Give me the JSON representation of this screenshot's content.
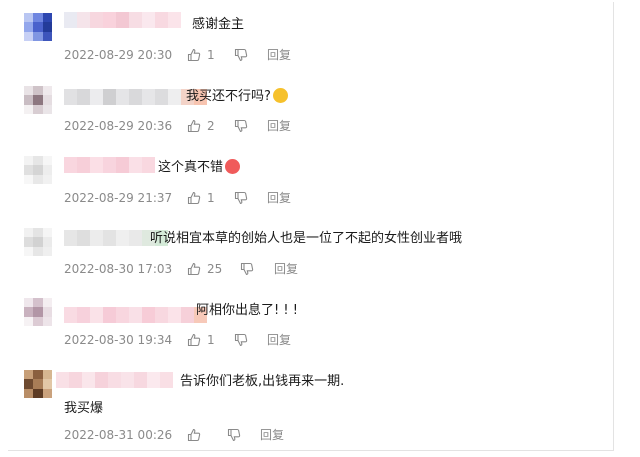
{
  "comments": [
    {
      "text": "感谢金主",
      "emoji": "",
      "time": "2022-08-29 20:30",
      "likes": "1",
      "reply_label": "回复",
      "avatar_colors": [
        "#b9c6f2",
        "#6f86e0",
        "#2d47b0",
        "#93a7ec",
        "#4a62cc",
        "#233b99",
        "#c7d0f5",
        "#8096e2",
        "#3d55bb"
      ],
      "name_colors": [
        "#e9eaf2",
        "#f5e4ea",
        "#f7d7df",
        "#f9d2dc",
        "#f3c8d3",
        "#f7dde4",
        "#fae8ee",
        "#f8d9e1",
        "#fbe4ea"
      ]
    },
    {
      "text": "我买还不行吗?",
      "emoji": "wink-face-emoji",
      "emoji_color": "#f6c12c",
      "time": "2022-08-29 20:36",
      "likes": "2",
      "reply_label": "回复",
      "avatar_colors": [
        "#e9e3e6",
        "#cfc3c8",
        "#efe9ec",
        "#c9bdc3",
        "#8d7780",
        "#e5dde1",
        "#f4f1f2",
        "#d8cdd2",
        "#eae5e8"
      ],
      "name_colors": [
        "#e1e1e3",
        "#d8d8da",
        "#ececee",
        "#cfcfd1",
        "#e5e5e7",
        "#d9d9db",
        "#e6e6e8",
        "#dcdcde",
        "#eeeeef",
        "#f3d3c8",
        "#f7c4b0"
      ]
    },
    {
      "text": "这个真不错",
      "emoji": "heart-eyes-emoji",
      "emoji_color": "#f05b5b",
      "time": "2022-08-29 21:37",
      "likes": "1",
      "reply_label": "回复",
      "avatar_colors": [
        "#f3f3f3",
        "#e6e6e6",
        "#f6f6f6",
        "#e0e0e0",
        "#d5d5d5",
        "#ededed",
        "#f7f7f7",
        "#e8e8e8",
        "#f1f1f1"
      ],
      "name_colors": [
        "#f9d6df",
        "#f7cfd9",
        "#fbdfe6",
        "#f8d4de",
        "#f6cbd6",
        "#fae0e7",
        "#f9d8e0"
      ]
    },
    {
      "text": "听说相宜本草的创始人也是一位了不起的女性创业者哦",
      "emoji": "",
      "time": "2022-08-30 17:03",
      "likes": "25",
      "reply_label": "回复",
      "avatar_colors": [
        "#f1f1f1",
        "#e4e4e4",
        "#f5f5f5",
        "#dddddd",
        "#d2d2d2",
        "#ebebeb",
        "#f6f6f6",
        "#e6e6e6",
        "#efefef"
      ],
      "name_colors": [
        "#e6e6e6",
        "#dedede",
        "#ececec",
        "#e3e3e3",
        "#efefef",
        "#e9e9e9",
        "#dfe9df",
        "#d4ead8"
      ]
    },
    {
      "text": "阿相你出息了! ! !",
      "emoji": "",
      "time": "2022-08-30 19:34",
      "likes": "1",
      "reply_label": "回复",
      "avatar_colors": [
        "#efe7ec",
        "#d4c1cc",
        "#f4eef1",
        "#c9b2bf",
        "#b296a6",
        "#e8dde3",
        "#f6f2f4",
        "#dccbd4",
        "#ede4e9"
      ],
      "name_colors": [
        "#f9dbe3",
        "#f7d1dc",
        "#fae2e8",
        "#f6cbd7",
        "#f8d6df",
        "#f9e0e7",
        "#f7ccd7",
        "#f8d8e0",
        "#fbe3e9",
        "#f6d0d9",
        "#f7c9b9"
      ]
    },
    {
      "text": "告诉你们老板,出钱再来一期.",
      "second_line": "我买爆",
      "emoji": "",
      "time": "2022-08-31 00:26",
      "likes": "",
      "reply_label": "回复",
      "avatar_colors": [
        "#c79f78",
        "#8a5f3e",
        "#d6b690",
        "#6e4a30",
        "#a87d57",
        "#e2c7a6",
        "#b88d66",
        "#5d3b24",
        "#caa27d"
      ],
      "name_colors": [
        "#f9e0e6",
        "#f7d6de",
        "#fae6eb",
        "#f6d2db",
        "#f8dde4",
        "#f9e3e9",
        "#f7d8e0",
        "#fbe9ee",
        "#f9dfe5"
      ]
    }
  ]
}
